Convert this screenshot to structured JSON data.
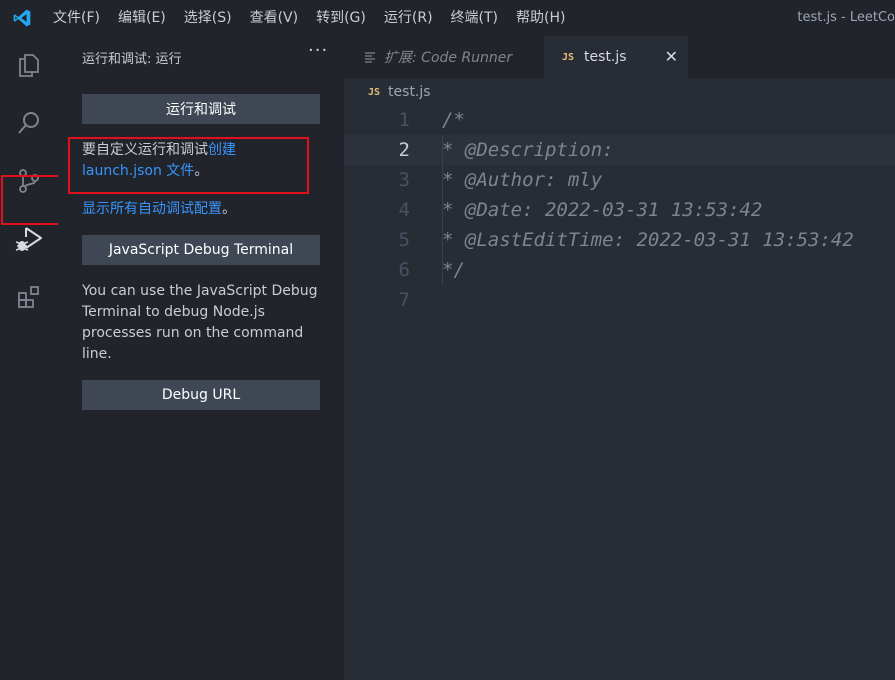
{
  "titlebar": {
    "menu": [
      "文件(F)",
      "编辑(E)",
      "选择(S)",
      "查看(V)",
      "转到(G)",
      "运行(R)",
      "终端(T)",
      "帮助(H)"
    ],
    "window_title": "test.js - LeetCo"
  },
  "activity_bar": {
    "items": [
      "explorer",
      "search",
      "source-control",
      "run-and-debug",
      "extensions"
    ],
    "active": "run-and-debug"
  },
  "sidebar": {
    "title": "运行和调试: 运行",
    "more": "···",
    "run_debug_button": "运行和调试",
    "customize_text": "要自定义运行和调试",
    "create_link": "创建",
    "launch_json_link": "launch.json 文件",
    "period": "。",
    "show_all_link": "显示所有自动调试配置",
    "show_all_period": "。",
    "js_terminal_button": "JavaScript Debug Terminal",
    "js_terminal_desc": [
      "You can use the JavaScript Debug",
      "Terminal to debug Node.js",
      "processes run on the command",
      "line."
    ],
    "debug_url_button": "Debug URL"
  },
  "tabs": [
    {
      "label": "扩展: Code Runner",
      "active": false
    },
    {
      "label": "test.js",
      "active": true,
      "icon": "JS"
    }
  ],
  "breadcrumb": {
    "icon": "JS",
    "file": "test.js"
  },
  "editor": {
    "active_line": 2,
    "lines": [
      {
        "no": "1",
        "code": "/*"
      },
      {
        "no": "2",
        "code": " * @Description:"
      },
      {
        "no": "3",
        "code": " * @Author: mly"
      },
      {
        "no": "4",
        "code": " * @Date: 2022-03-31 13:53:42"
      },
      {
        "no": "5",
        "code": " * @LastEditTime: 2022-03-31 13:53:42"
      },
      {
        "no": "6",
        "code": " */"
      },
      {
        "no": "7",
        "code": ""
      }
    ]
  },
  "colors": {
    "accent_link": "#3794ff",
    "highlight_red": "#e0101d",
    "js_icon": "#e5c07b",
    "vscode_blue": "#23a9f2"
  }
}
